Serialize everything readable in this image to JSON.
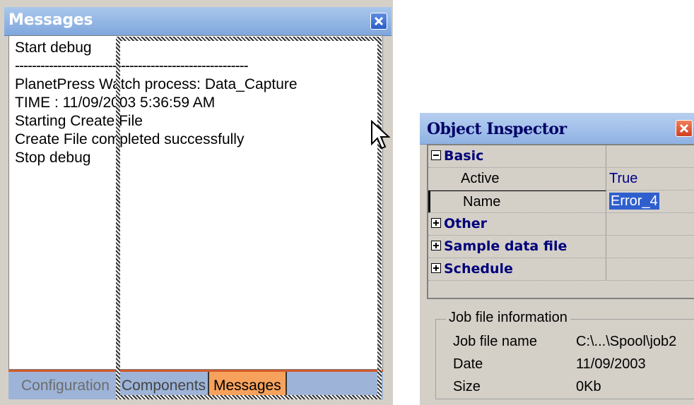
{
  "messages_panel": {
    "title": "Messages",
    "lines": [
      "Start debug",
      "-------------------------------------------------------",
      "PlanetPress Watch process: Data_Capture",
      "TIME : 11/09/2003 5:36:59 AM",
      "Starting Create File",
      "Create File completed successfully",
      "Stop debug"
    ],
    "tabs": [
      "Configuration",
      "Components",
      "Messages"
    ],
    "active_tab": "Messages"
  },
  "object_inspector": {
    "title": "Object Inspector",
    "rows": [
      {
        "name": "Basic",
        "type": "category",
        "expanded": true,
        "value": ""
      },
      {
        "name": "Active",
        "type": "property",
        "value": "True"
      },
      {
        "name": "Name",
        "type": "property",
        "value": "Error_4",
        "editing": true
      },
      {
        "name": "Other",
        "type": "category",
        "expanded": false,
        "value": ""
      },
      {
        "name": "Sample data file",
        "type": "category",
        "expanded": false,
        "value": ""
      },
      {
        "name": "Schedule",
        "type": "category",
        "expanded": false,
        "value": ""
      }
    ],
    "job_info": {
      "legend": "Job file information",
      "file_name_label": "Job file name",
      "file_name_value": "C:\\...\\Spool\\job2",
      "date_label": "Date",
      "date_value": "11/09/2003",
      "size_label": "Size",
      "size_value": "0Kb"
    }
  },
  "colors": {
    "title_blue": "#7fa7dd",
    "active_tab": "#f7a25c",
    "tab_strip": "#9db4d8",
    "selection": "#2f5fcf",
    "category_text": "#00007a"
  }
}
